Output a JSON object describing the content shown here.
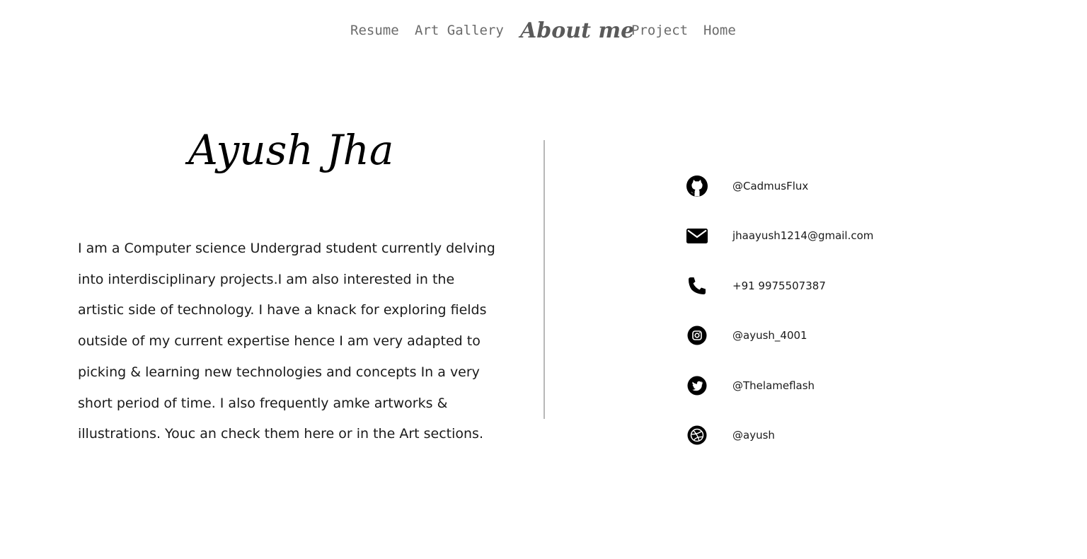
{
  "nav": {
    "items": [
      {
        "label": "Resume"
      },
      {
        "label": "Art Gallery"
      },
      {
        "label": "About me"
      },
      {
        "label": "Project"
      },
      {
        "label": "Home"
      }
    ],
    "active": "About me"
  },
  "profile": {
    "name": "Ayush Jha",
    "bio": "I am a Computer science Undergrad student currently delving into interdisciplinary projects.I am also interested in the artistic side of technology. I have a knack for exploring fields outside of my current expertise hence I am very adapted to picking & learning new technologies and concepts In a very short period of time. I also frequently amke artworks & illustrations. Youc an check them here or in the Art sections."
  },
  "contacts": [
    {
      "icon": "github-icon",
      "value": "@CadmusFlux"
    },
    {
      "icon": "mail-icon",
      "value": "jhaayush1214@gmail.com"
    },
    {
      "icon": "phone-icon",
      "value": "+91 9975507387"
    },
    {
      "icon": "instagram-icon",
      "value": "@ayush_4001"
    },
    {
      "icon": "twitter-icon",
      "value": "@Thelameflash"
    },
    {
      "icon": "dribbble-icon",
      "value": "@ayush"
    }
  ],
  "colors": {
    "nav_text": "#6b6b6b",
    "active_nav": "#5a5a5a",
    "divider": "#b8b8b8",
    "text": "#1a1a1a"
  }
}
